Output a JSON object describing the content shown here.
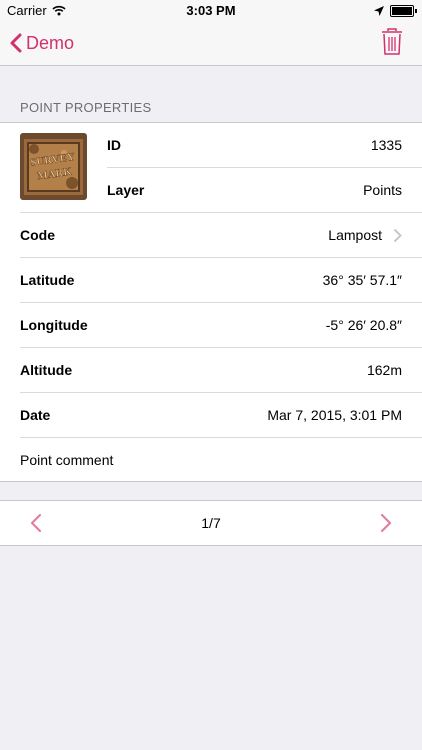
{
  "status_bar": {
    "carrier": "Carrier",
    "time": "3:03 PM"
  },
  "nav": {
    "back_label": "Demo"
  },
  "section": {
    "title": "POINT PROPERTIES"
  },
  "properties": {
    "id": {
      "label": "ID",
      "value": "1335"
    },
    "layer": {
      "label": "Layer",
      "value": "Points"
    },
    "code": {
      "label": "Code",
      "value": "Lampost"
    },
    "latitude": {
      "label": "Latitude",
      "value": "36° 35′ 57.1″"
    },
    "longitude": {
      "label": "Longitude",
      "value": "-5° 26′ 20.8″"
    },
    "altitude": {
      "label": "Altitude",
      "value": "162m"
    },
    "date": {
      "label": "Date",
      "value": "Mar 7, 2015, 3:01 PM"
    },
    "comment": "Point comment"
  },
  "thumbnail": {
    "text_line1": "SURVEY",
    "text_line2": "MARK"
  },
  "pager": {
    "label": "1/7"
  },
  "colors": {
    "accent": "#d1316d",
    "background": "#efeff4",
    "separator": "#c8c7cc"
  }
}
